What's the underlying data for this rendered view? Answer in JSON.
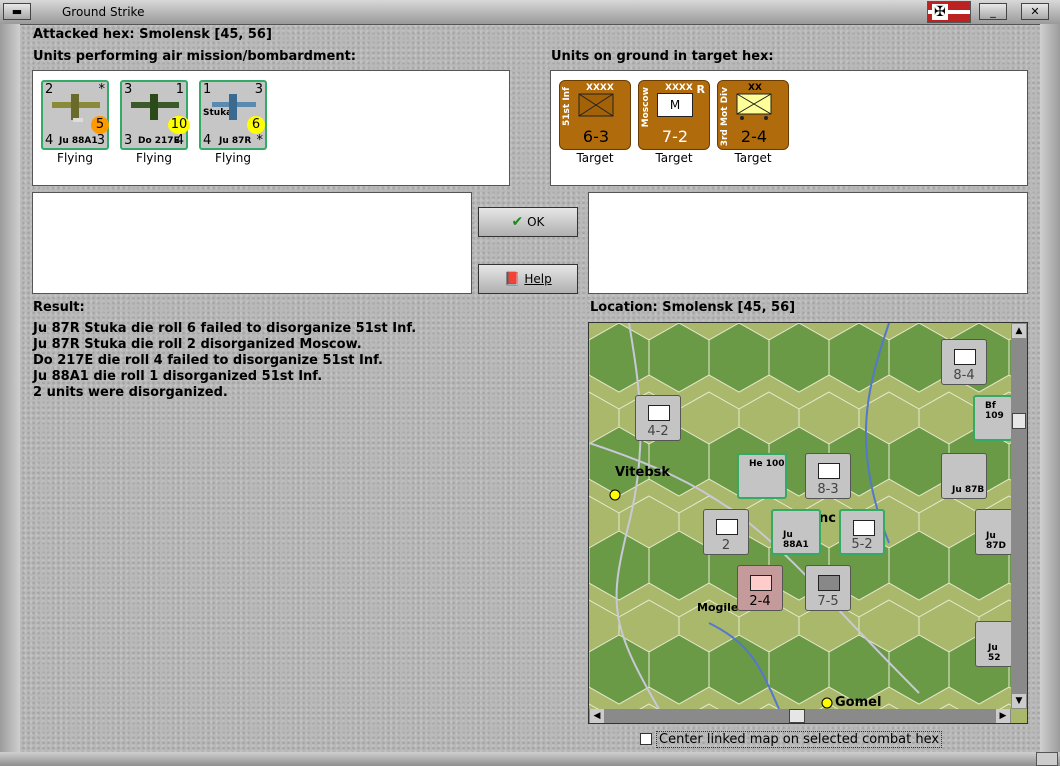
{
  "window": {
    "title": "Ground Strike"
  },
  "attacked_hex": "Attacked hex: Smolensk  [45, 56]",
  "air_panel": {
    "label": "Units performing air mission/bombardment:",
    "units": [
      {
        "name": "Ju 88A1",
        "tl": "2",
        "tr": "*",
        "bl": "4",
        "br": "3",
        "badge": "5",
        "status": "Flying"
      },
      {
        "name": "Do 217E",
        "tl": "3",
        "tr": "1",
        "bl": "3",
        "br": "4",
        "badge": "10",
        "status": "Flying"
      },
      {
        "name": "Ju 87R",
        "tl": "1",
        "tr": "3",
        "bl": "4",
        "br": "*",
        "badge": "6",
        "label_top": "Stuka",
        "status": "Flying"
      }
    ]
  },
  "ground_panel": {
    "label": "Units on ground in target hex:",
    "units": [
      {
        "name": "51st Inf",
        "size": "XXXX",
        "value": "6-3",
        "status": "Target"
      },
      {
        "name": "Moscow",
        "size": "XXXX",
        "value": "7-2",
        "extra": "R",
        "symbol": "M",
        "status": "Target"
      },
      {
        "name": "3rd Mot Div",
        "size": "XX",
        "value": "2-4",
        "status": "Target"
      }
    ]
  },
  "buttons": {
    "ok": "OK",
    "help": "Help"
  },
  "result": {
    "label": "Result:",
    "lines": [
      "Ju 87R Stuka die roll 6 failed to disorganize 51st Inf.",
      "Ju 87R Stuka die roll 2 disorganized Moscow.",
      "Do 217E die roll 4 failed to disorganize 51st Inf.",
      "Ju 88A1 die roll 1 disorganized 51st Inf.",
      "2 units were disorganized."
    ]
  },
  "location": {
    "label": "Location:  Smolensk  [45, 56]",
    "cities": {
      "vitebsk": "Vitebsk",
      "mogilev": "Mogile",
      "gomel": "Gomel",
      "smolensk_partial": "nc"
    },
    "map_counters": {
      "c1": "4-2",
      "c2": "8-3",
      "c3": "8-4",
      "c4": "2",
      "c5": "5-2",
      "c6": "2-4",
      "c7": "7-5",
      "he100": "He 100",
      "bf109": "Bf 109",
      "ju87b": "Ju 87B",
      "ju87d": "Ju 87D",
      "ju52": "Ju 52",
      "ju88a1": "Ju 88A1"
    }
  },
  "checkbox": {
    "label": "Center linked map on selected combat hex",
    "checked": false
  },
  "colors": {
    "bg": "#b9b9b9",
    "target_counter": "#b06c0c",
    "map_green": "#5f8a3c",
    "map_light": "#a9b86a"
  }
}
